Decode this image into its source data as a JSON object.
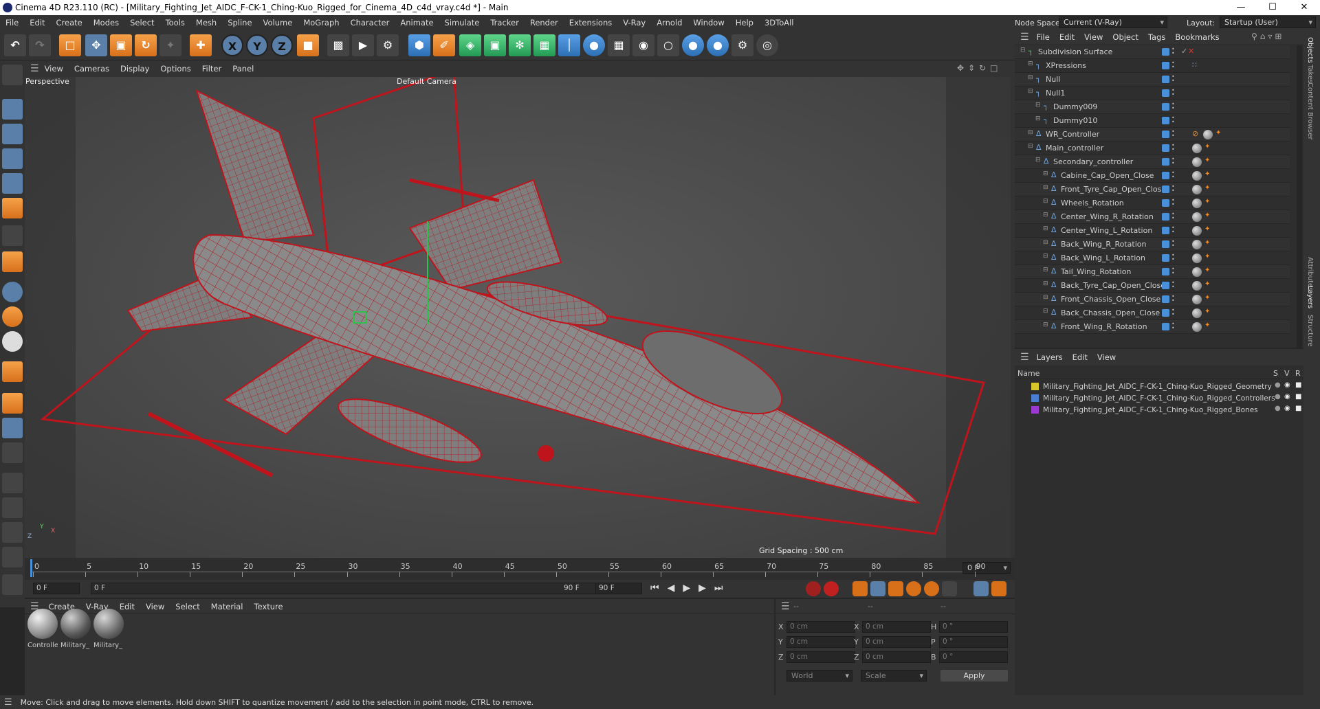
{
  "window": {
    "title": "Cinema 4D R23.110 (RC) - [Military_Fighting_Jet_AIDC_F-CK-1_Ching-Kuo_Rigged_for_Cinema_4D_c4d_vray.c4d *] - Main",
    "minimize": "—",
    "maximize": "☐",
    "close": "✕"
  },
  "menu": [
    "File",
    "Edit",
    "Create",
    "Modes",
    "Select",
    "Tools",
    "Mesh",
    "Spline",
    "Volume",
    "MoGraph",
    "Character",
    "Animate",
    "Simulate",
    "Tracker",
    "Render",
    "Extensions",
    "V-Ray",
    "Arnold",
    "Window",
    "Help",
    "3DToAll"
  ],
  "nodespace": {
    "label": "Node Space:",
    "value": "Current (V-Ray)",
    "layout_label": "Layout:",
    "layout_value": "Startup (User)"
  },
  "toolbar": {
    "axis_x": "X",
    "axis_y": "Y",
    "axis_z": "Z"
  },
  "viewport": {
    "menu": [
      "View",
      "Cameras",
      "Display",
      "Options",
      "Filter",
      "Panel"
    ],
    "name": "Perspective",
    "camera": "Default Camera",
    "grid_spacing": "Grid Spacing : 500 cm",
    "axis_x": "X",
    "axis_y": "Y",
    "axis_z": "Z"
  },
  "timeline": {
    "ticks": [
      "0",
      "5",
      "10",
      "15",
      "20",
      "25",
      "30",
      "35",
      "40",
      "45",
      "50",
      "55",
      "60",
      "65",
      "70",
      "75",
      "80",
      "85",
      "90"
    ],
    "frame_field": "0 F"
  },
  "transport": {
    "start": "0 F",
    "current": "0 F",
    "end_inner": "90 F",
    "end": "90 F"
  },
  "material_menu": [
    "Create",
    "V-Ray",
    "Edit",
    "View",
    "Select",
    "Material",
    "Texture"
  ],
  "materials": [
    "Controlle",
    "Military_",
    "Military_"
  ],
  "coords": {
    "dashes": [
      "--",
      "--",
      "--"
    ],
    "rows": [
      {
        "a": "X",
        "av": "0 cm",
        "b": "X",
        "bv": "0 cm",
        "c": "H",
        "cv": "0 °"
      },
      {
        "a": "Y",
        "av": "0 cm",
        "b": "Y",
        "bv": "0 cm",
        "c": "P",
        "cv": "0 °"
      },
      {
        "a": "Z",
        "av": "0 cm",
        "b": "Z",
        "bv": "0 cm",
        "c": "B",
        "cv": "0 °"
      }
    ],
    "mode1": "World",
    "mode2": "Scale",
    "apply": "Apply"
  },
  "objects": {
    "menu": [
      "File",
      "Edit",
      "View",
      "Object",
      "Tags",
      "Bookmarks"
    ],
    "items": [
      {
        "name": "Subdivision Surface",
        "indent": 0
      },
      {
        "name": "XPressions",
        "indent": 1
      },
      {
        "name": "Null",
        "indent": 1
      },
      {
        "name": "Null1",
        "indent": 1
      },
      {
        "name": "Dummy009",
        "indent": 2
      },
      {
        "name": "Dummy010",
        "indent": 2
      },
      {
        "name": "WR_Controller",
        "indent": 1
      },
      {
        "name": "Main_controller",
        "indent": 1
      },
      {
        "name": "Secondary_controller",
        "indent": 2
      },
      {
        "name": "Cabine_Cap_Open_Close",
        "indent": 3
      },
      {
        "name": "Front_Tyre_Cap_Open_Close",
        "indent": 3
      },
      {
        "name": "Wheels_Rotation",
        "indent": 3
      },
      {
        "name": "Center_Wing_R_Rotation",
        "indent": 3
      },
      {
        "name": "Center_Wing_L_Rotation",
        "indent": 3
      },
      {
        "name": "Back_Wing_R_Rotation",
        "indent": 3
      },
      {
        "name": "Back_Wing_L_Rotation",
        "indent": 3
      },
      {
        "name": "Tail_Wing_Rotation",
        "indent": 3
      },
      {
        "name": "Back_Tyre_Cap_Open_Close",
        "indent": 3
      },
      {
        "name": "Front_Chassis_Open_Close",
        "indent": 3
      },
      {
        "name": "Back_Chassis_Open_Close",
        "indent": 3
      },
      {
        "name": "Front_Wing_R_Rotation",
        "indent": 3
      }
    ]
  },
  "layers": {
    "menu": [
      "Layers",
      "Edit",
      "View"
    ],
    "header_name": "Name",
    "cols": [
      "S",
      "V",
      "R"
    ],
    "items": [
      {
        "name": "Military_Fighting_Jet_AIDC_F-CK-1_Ching-Kuo_Rigged_Geometry",
        "color": "#d8c82a"
      },
      {
        "name": "Military_Fighting_Jet_AIDC_F-CK-1_Ching-Kuo_Rigged_Controllers",
        "color": "#4a7ed0"
      },
      {
        "name": "Military_Fighting_Jet_AIDC_F-CK-1_Ching-Kuo_Rigged_Bones",
        "color": "#9a3ad0"
      }
    ]
  },
  "sidetabs": [
    "Objects",
    "Takes",
    "Content Browser",
    "Attributes",
    "Layers",
    "Structure"
  ],
  "status": "Move: Click and drag to move elements. Hold down SHIFT to quantize movement / add to the selection in point mode, CTRL to remove.",
  "colors": {
    "wire": "#c0141c",
    "accent": "#4a90d9",
    "panel": "#333333"
  }
}
